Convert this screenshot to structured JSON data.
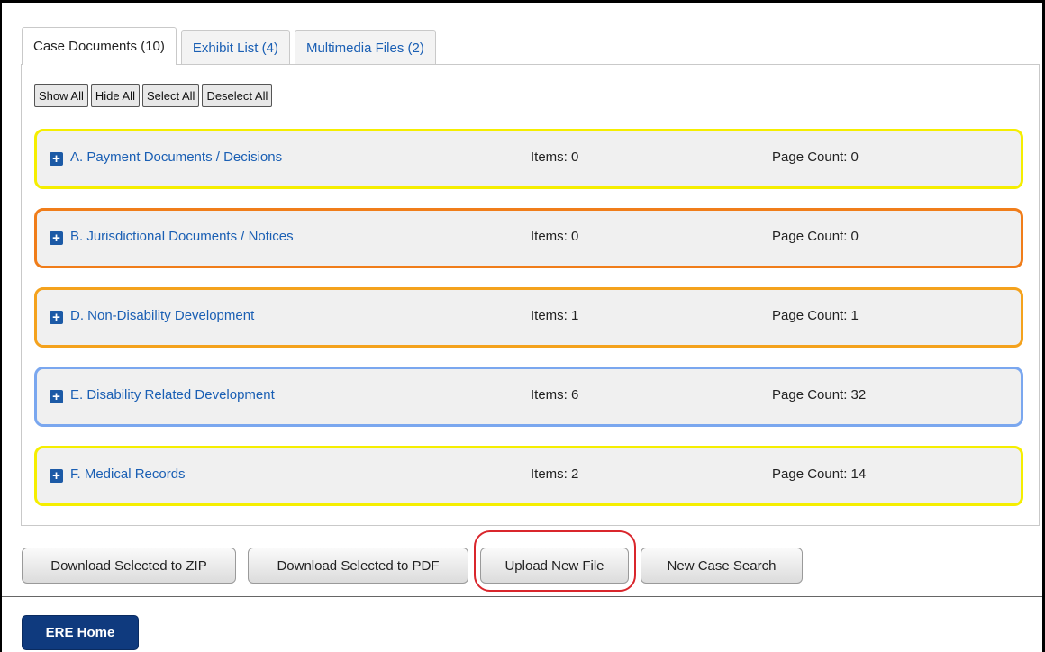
{
  "tabs": [
    {
      "label": "Case Documents (10)",
      "active": true
    },
    {
      "label": "Exhibit List (4)",
      "active": false
    },
    {
      "label": "Multimedia Files (2)",
      "active": false
    }
  ],
  "toolbar": {
    "show_all": "Show All",
    "hide_all": "Hide All",
    "select_all": "Select All",
    "deselect_all": "Deselect All"
  },
  "sections": [
    {
      "title": "A. Payment Documents / Decisions",
      "items": "Items: 0",
      "page_count": "Page Count: 0",
      "border_color": "#f5ee00"
    },
    {
      "title": "B. Jurisdictional Documents / Notices",
      "items": "Items: 0",
      "page_count": "Page Count: 0",
      "border_color": "#f07d1a"
    },
    {
      "title": "D. Non-Disability Development",
      "items": "Items: 1",
      "page_count": "Page Count: 1",
      "border_color": "#f4a21d"
    },
    {
      "title": "E. Disability Related Development",
      "items": "Items: 6",
      "page_count": "Page Count: 32",
      "border_color": "#7aa7ef"
    },
    {
      "title": "F. Medical Records",
      "items": "Items: 2",
      "page_count": "Page Count: 14",
      "border_color": "#f5ee00"
    }
  ],
  "actions": {
    "download_zip": "Download Selected to ZIP",
    "download_pdf": "Download Selected to PDF",
    "upload": "Upload New File",
    "new_search": "New Case Search"
  },
  "home_button": "ERE Home",
  "icons": {
    "expand": "plus-square-icon"
  },
  "colors": {
    "link": "#1a5fb4",
    "home_button": "#0f3a7e",
    "highlight": "#d9262c"
  }
}
